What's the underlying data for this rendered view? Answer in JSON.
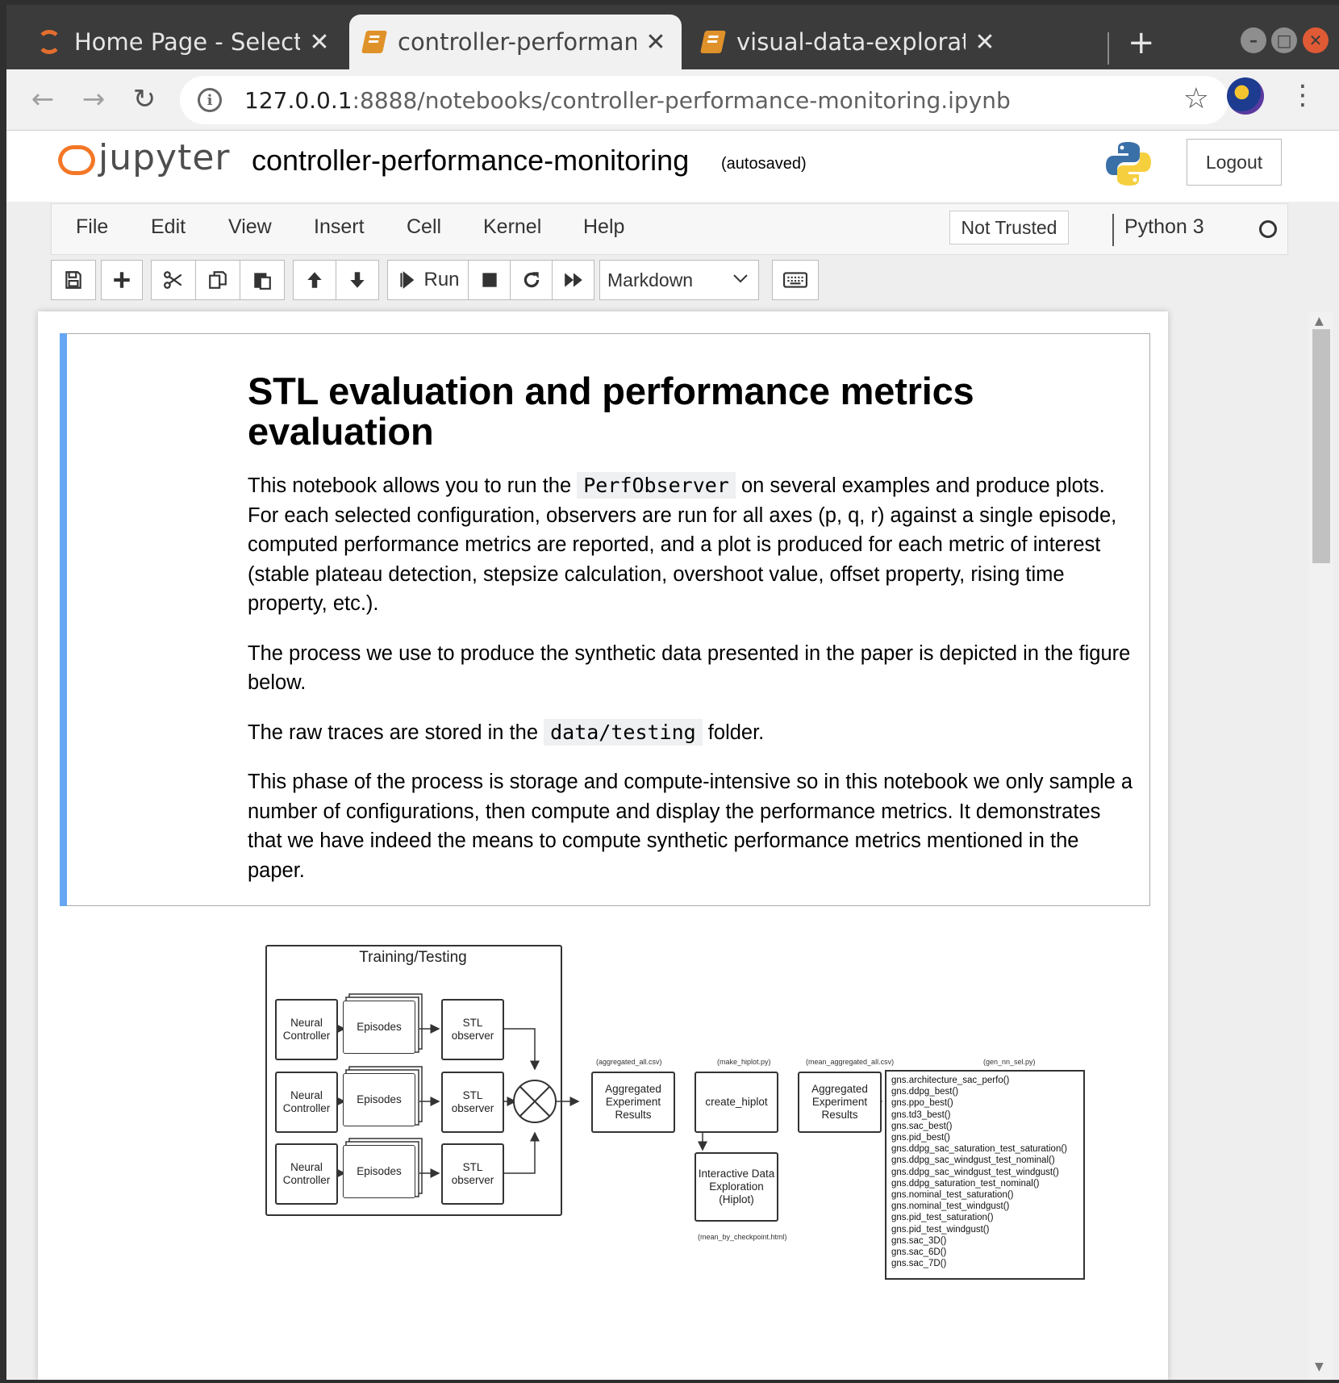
{
  "browser": {
    "tabs": [
      {
        "title": "Home Page - Select or create a notebook",
        "icon": "jupyter-ring-icon",
        "active": false
      },
      {
        "title": "controller-performance-monitoring",
        "icon": "notebook-icon",
        "active": true
      },
      {
        "title": "visual-data-exploration",
        "icon": "notebook-icon",
        "active": false
      }
    ],
    "new_tab": "+",
    "url_host": "127.0.0.1",
    "url_rest": ":8888/notebooks/controller-performance-monitoring.ipynb"
  },
  "jupyter": {
    "logo_text": "jupyter",
    "notebook_title": "controller-performance-monitoring",
    "autosave": "(autosaved)",
    "logout": "Logout",
    "menu": [
      "File",
      "Edit",
      "View",
      "Insert",
      "Cell",
      "Kernel",
      "Help"
    ],
    "trust": "Not Trusted",
    "kernel": "Python 3",
    "toolbar": {
      "run": "Run",
      "cell_type": "Markdown"
    }
  },
  "cell": {
    "title": "STL evaluation and performance metrics evaluation",
    "p1_before": "This notebook allows you to run the ",
    "p1_code": "PerfObserver",
    "p1_after": " on several examples and produce plots. For each selected configuration, observers are run for all axes (p, q, r) against a single episode, computed performance metrics are reported, and a plot is produced for each metric of interest (stable plateau detection, stepsize calculation, overshoot value, offset property, rising time property, etc.).",
    "p2": "The process we use to produce the synthetic data presented in the paper is depicted in the figure below.",
    "p3_before": "The raw traces are stored in the ",
    "p3_code": "data/testing",
    "p3_after": " folder.",
    "p4": "This phase of the process is storage and compute-intensive so in this notebook we only sample a number of configurations, then compute and display the performance metrics. It demonstrates that we have indeed the means to compute synthetic performance metrics mentioned in the paper."
  },
  "diagram": {
    "group_title": "Training/Testing",
    "neural_controller": "Neural Controller",
    "episodes": "Episodes",
    "stl_observer": "STL observer",
    "aggregated_label": "(aggregated_all.csv)",
    "aggregated": "Aggregated Experiment Results",
    "make_hiplot_label": "(make_hiplot.py)",
    "create_hiplot": "create_hiplot",
    "mean_aggregated_label": "(mean_aggregated_all.csv)",
    "aggregated2": "Aggregated Experiment Results",
    "gen_label": "(gen_nn_sel.py)",
    "interactive": "Interactive Data Exploration (Hiplot)",
    "mean_by_checkpoint": "(mean_by_checkpoint.html)",
    "functions": [
      "gns.architecture_sac_perfo()",
      "gns.ddpg_best()",
      "gns.ppo_best()",
      "gns.td3_best()",
      "gns.sac_best()",
      "gns.pid_best()",
      "gns.ddpg_sac_saturation_test_saturation()",
      "gns.ddpg_sac_windgust_test_nominal()",
      "gns.ddpg_sac_windgust_test_windgust()",
      "gns.ddpg_saturation_test_nominal()",
      "gns.nominal_test_saturation()",
      "gns.nominal_test_windgust()",
      "gns.pid_test_saturation()",
      "gns.pid_test_windgust()",
      "gns.sac_3D()",
      "gns.sac_6D()",
      "gns.sac_7D()"
    ]
  },
  "colors": {
    "jupyter_orange": "#f37726",
    "selection_blue": "#66a6f3",
    "chrome_dark": "#3b3b3b"
  }
}
